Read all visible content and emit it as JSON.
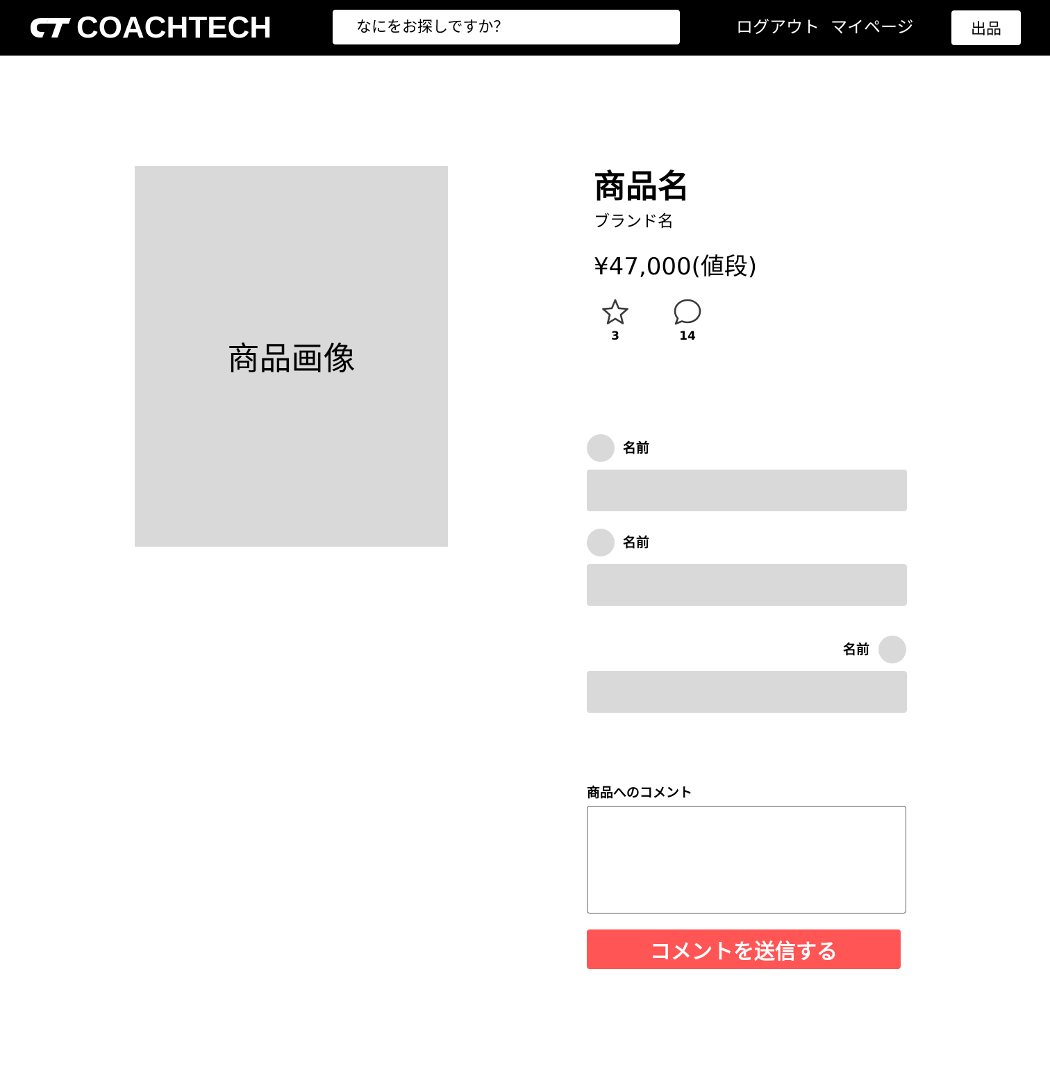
{
  "header": {
    "logo_text": "COACHTECH",
    "logo_icon": "ct-logo-icon",
    "search_placeholder": "なにをお探しですか？",
    "logout_label": "ログアウト",
    "mypage_label": "マイページ",
    "sell_label": "出品"
  },
  "product": {
    "image_label": "商品画像",
    "name": "商品名",
    "brand": "ブランド名",
    "price": "¥47,000(値段)",
    "favorites_icon": "star-icon",
    "favorites_count": "3",
    "comments_icon": "speech-bubble-icon",
    "comments_count": "14"
  },
  "comments": [
    {
      "name": "名前",
      "text": "",
      "align": "left"
    },
    {
      "name": "名前",
      "text": "",
      "align": "left"
    },
    {
      "name": "名前",
      "text": "",
      "align": "right"
    }
  ],
  "comment_form": {
    "label": "商品へのコメント",
    "textarea_value": "",
    "submit_label": "コメントを送信する"
  },
  "colors": {
    "header_bg": "#000000",
    "placeholder_gray": "#d9d9d9",
    "accent": "#ff5555"
  }
}
